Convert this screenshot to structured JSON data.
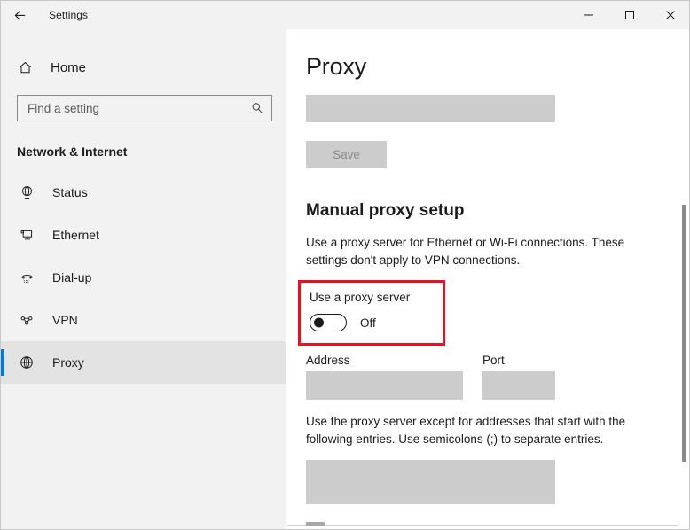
{
  "window": {
    "app_title": "Settings",
    "back_icon": "back-arrow-icon",
    "controls": {
      "minimize": "minimize-icon",
      "maximize": "maximize-icon",
      "close": "close-icon"
    }
  },
  "sidebar": {
    "home_label": "Home",
    "home_icon": "home-icon",
    "search": {
      "value": "",
      "placeholder": "Find a setting",
      "icon": "search-icon"
    },
    "section_title": "Network & Internet",
    "accent_color": "#0078d7",
    "items": [
      {
        "label": "Status",
        "icon": "status-globe-icon",
        "selected": false
      },
      {
        "label": "Ethernet",
        "icon": "ethernet-icon",
        "selected": false
      },
      {
        "label": "Dial-up",
        "icon": "dialup-phone-icon",
        "selected": false
      },
      {
        "label": "VPN",
        "icon": "vpn-icon",
        "selected": false
      },
      {
        "label": "Proxy",
        "icon": "proxy-globe-icon",
        "selected": true
      }
    ]
  },
  "main": {
    "page_title": "Proxy",
    "script_address_value": "",
    "save_label": "Save",
    "save_disabled": true,
    "manual_section": {
      "heading": "Manual proxy setup",
      "description": "Use a proxy server for Ethernet or Wi-Fi connections. These settings don't apply to VPN connections.",
      "toggle": {
        "label": "Use a proxy server",
        "state": "Off",
        "highlighted": true,
        "highlight_color": "#e81123"
      },
      "address": {
        "label": "Address",
        "value": ""
      },
      "port": {
        "label": "Port",
        "value": ""
      },
      "exceptions": {
        "description": "Use the proxy server except for addresses that start with the following entries. Use semicolons (;) to separate entries.",
        "value": ""
      }
    }
  },
  "scrollbar": {
    "name": "content-scrollbar"
  }
}
